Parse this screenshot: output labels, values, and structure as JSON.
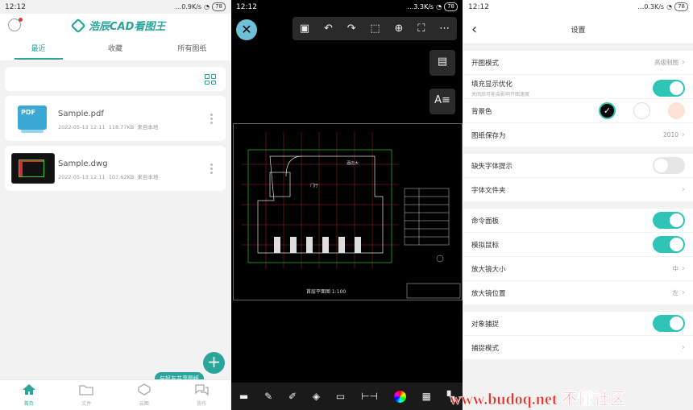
{
  "panel1": {
    "status_time": "12:12",
    "status_speed": "…0.9K/s",
    "status_battery": "78",
    "app_name": "浩辰CAD看图王",
    "tabs": [
      "最近",
      "收藏",
      "所有图纸"
    ],
    "files": [
      {
        "name": "Sample.pdf",
        "date": "2022-05-13 12:11",
        "size": "118.77KB",
        "source": "来自本地",
        "thumb_label": "PDF"
      },
      {
        "name": "Sample.dwg",
        "date": "2022-05-13 12:11",
        "size": "107.62KB",
        "source": "来自本地"
      }
    ],
    "share_tip": "与好友共享图纸",
    "bottom_nav": [
      "首页",
      "文件",
      "云图",
      "协作"
    ]
  },
  "panel2": {
    "status_time": "12:12",
    "status_speed": "…3.3K/s",
    "status_battery": "78",
    "drawing_title": "首层平面图 1:100",
    "drawing_room_label": "门厅",
    "drawing_side_label": "酒店大"
  },
  "panel3": {
    "status_time": "12:12",
    "status_speed": "…0.3K/s",
    "status_battery": "78",
    "title": "设置",
    "rows": {
      "open_mode": {
        "label": "开图模式",
        "value": "高级制图"
      },
      "fill_opt": {
        "label": "填充显示优化",
        "sub": "关闭后可能会影响开图速度",
        "on": true
      },
      "bg_color": {
        "label": "背景色",
        "swatches": [
          "#000000",
          "#ffffff",
          "#fbe3d6"
        ]
      },
      "save_as": {
        "label": "图纸保存为",
        "value": "2010"
      },
      "missing_font": {
        "label": "缺失字体提示",
        "on": false
      },
      "font_folder": {
        "label": "字体文件夹"
      },
      "cmd_panel": {
        "label": "命令面板",
        "on": true
      },
      "sim_mouse": {
        "label": "模拟鼠标",
        "on": true
      },
      "mag_size": {
        "label": "放大镜大小",
        "value": "中"
      },
      "mag_pos": {
        "label": "放大镜位置",
        "value": "左"
      },
      "snap": {
        "label": "对象捕捉",
        "on": true
      },
      "snap_mode": {
        "label": "捕捉模式"
      }
    }
  },
  "watermark": "www.budoq.net 不懂社区"
}
